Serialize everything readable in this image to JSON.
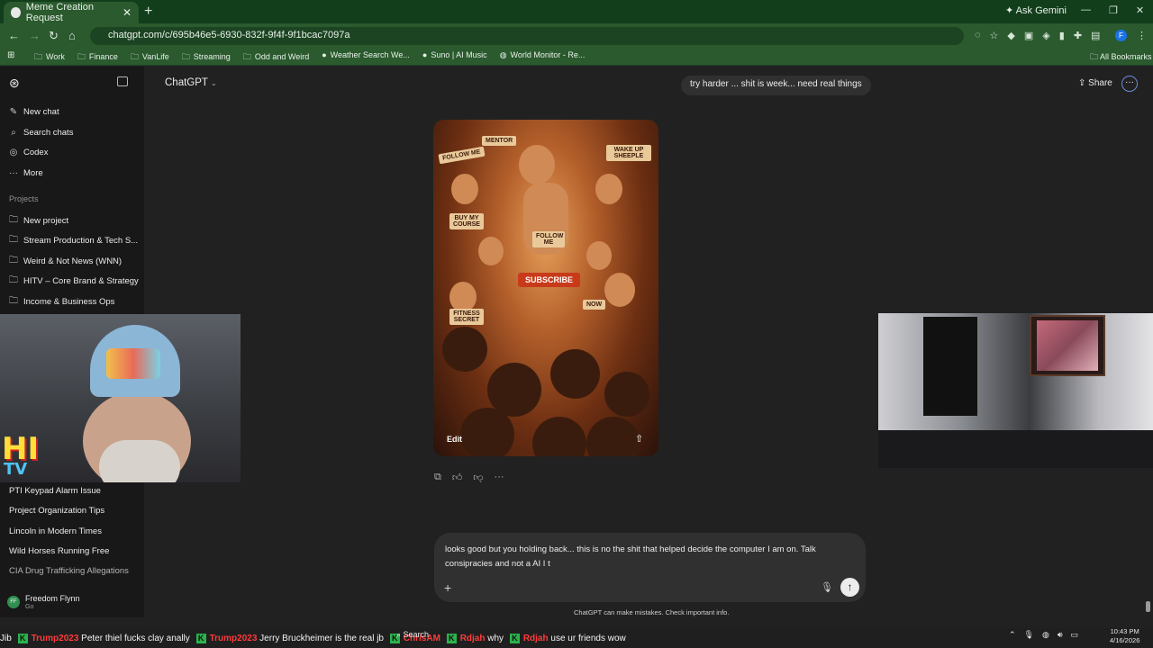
{
  "browser": {
    "tab_title": "Meme Creation Request",
    "new_tab": "+",
    "ask_gemini": "Ask Gemini",
    "url": "chatgpt.com/c/695b46e5-6930-832f-9f4f-9f1bcac7097a",
    "bookmarks": [
      "Work",
      "Finance",
      "VanLife",
      "Streaming",
      "Odd and Weird",
      "Weather Search We...",
      "Suno | AI Music",
      "World Monitor - Re..."
    ],
    "all_bookmarks": "All Bookmarks",
    "profile_initial": "F"
  },
  "sidebar": {
    "items": [
      {
        "label": "New chat",
        "icon": "pencil-square-icon"
      },
      {
        "label": "Search chats",
        "icon": "search-icon"
      },
      {
        "label": "Codex",
        "icon": "codex-icon"
      },
      {
        "label": "More",
        "icon": "more-dots-icon"
      }
    ],
    "projects_heading": "Projects",
    "projects": [
      {
        "label": "New project",
        "icon": "folder-plus-icon"
      },
      {
        "label": "Stream Production & Tech S...",
        "icon": "folder-icon"
      },
      {
        "label": "Weird & Not News (WNN)",
        "icon": "folder-icon"
      },
      {
        "label": "HITV – Core Brand & Strategy",
        "icon": "folder-icon"
      },
      {
        "label": "Income & Business Ops",
        "icon": "folder-icon"
      }
    ],
    "chats": [
      "PTI Keypad Alarm Issue",
      "Project Organization Tips",
      "Lincoln in Modern Times",
      "Wild Horses Running Free",
      "CIA Drug Trafficking Allegations"
    ],
    "user": {
      "initials": "FF",
      "name": "Freedom Flynn",
      "plan": "Go"
    }
  },
  "header": {
    "model": "ChatGPT",
    "share": "Share"
  },
  "conversation": {
    "user_message": "try harder ... shit is week... need real things",
    "image_signs": [
      "MENTOR",
      "FOLLOW ME",
      "WAKE UP SHEEPLE",
      "BUY MY COURSE",
      "FOLLOW ME",
      "SUBSCRIBE",
      "FITNESS SECRET",
      "NOW"
    ],
    "image_edit": "Edit"
  },
  "composer": {
    "text": "looks good but you holding back... this is no the shit that helped decide the computer I am on. Talk consipracies and not a AI I t",
    "disclaimer": "ChatGPT can make mistakes. Check important info."
  },
  "overlay": {
    "logo_text": "HI",
    "logo_sub": "TV"
  },
  "taskbar": {
    "ticker": [
      {
        "prefix": "Jib"
      },
      {
        "user": "Trump2023",
        "msg": "Peter thiel fucks clay anally"
      },
      {
        "user": "Trump2023",
        "msg": "Jerry Bruckheimer is the real jb"
      },
      {
        "user": "ChrisAM",
        "msg": ""
      },
      {
        "user": "Rdjah",
        "msg": "why"
      },
      {
        "user": "Rdjah",
        "msg": "use ur friends wow"
      }
    ],
    "search": "Search",
    "time": "10:43 PM",
    "date": "4/16/2026"
  }
}
